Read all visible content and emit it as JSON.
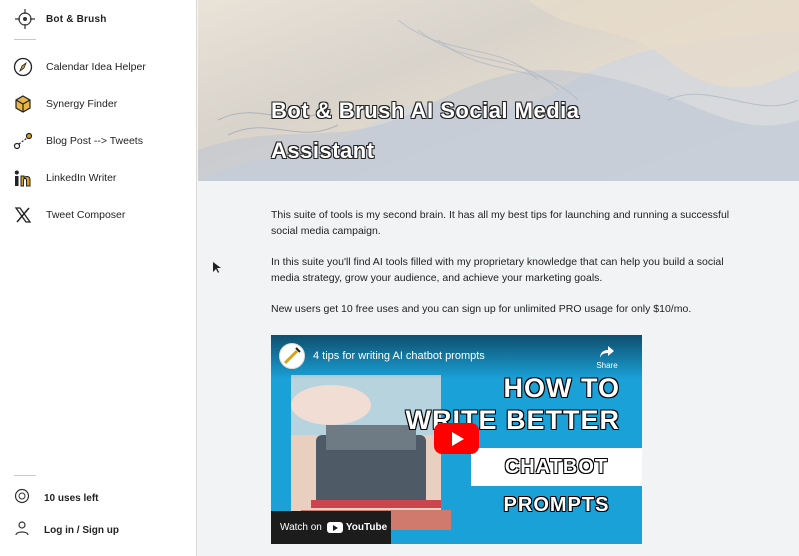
{
  "sidebar": {
    "brand": {
      "name": "Bot & Brush",
      "icon": "bot-brush-logo-icon"
    },
    "items": [
      {
        "label": "Calendar Idea Helper",
        "icon": "compass-icon"
      },
      {
        "label": "Synergy Finder",
        "icon": "cube-icon"
      },
      {
        "label": "Blog Post --> Tweets",
        "icon": "flow-icon"
      },
      {
        "label": "LinkedIn Writer",
        "icon": "linkedin-icon"
      },
      {
        "label": "Tweet Composer",
        "icon": "x-icon"
      }
    ],
    "bottom": [
      {
        "label": "10 uses left",
        "icon": "coin-icon"
      },
      {
        "label": "Log in / Sign up",
        "icon": "user-icon"
      }
    ]
  },
  "main": {
    "hero_title": "Bot & Brush AI Social Media Assistant",
    "paragraphs": [
      "This suite of tools is my second brain. It has all my best tips for launching and running a successful social media campaign.",
      "In this suite you'll find AI tools filled with my proprietary knowledge that can help you build a social media strategy, grow your audience, and achieve your marketing goals.",
      "New users get 10 free uses and you can sign up for unlimited PRO usage for only $10/mo."
    ],
    "video": {
      "title": "4 tips for writing AI chatbot prompts",
      "share_label": "Share",
      "overlay": [
        "HOW TO",
        "WRITE BETTER",
        "CHATBOT PROMPTS"
      ],
      "watch_on": "Watch on",
      "platform": "YouTube"
    }
  },
  "colors": {
    "accent": "#d9a21b",
    "youtube_red": "#ff0000",
    "video_bg": "#1aa1d8"
  }
}
